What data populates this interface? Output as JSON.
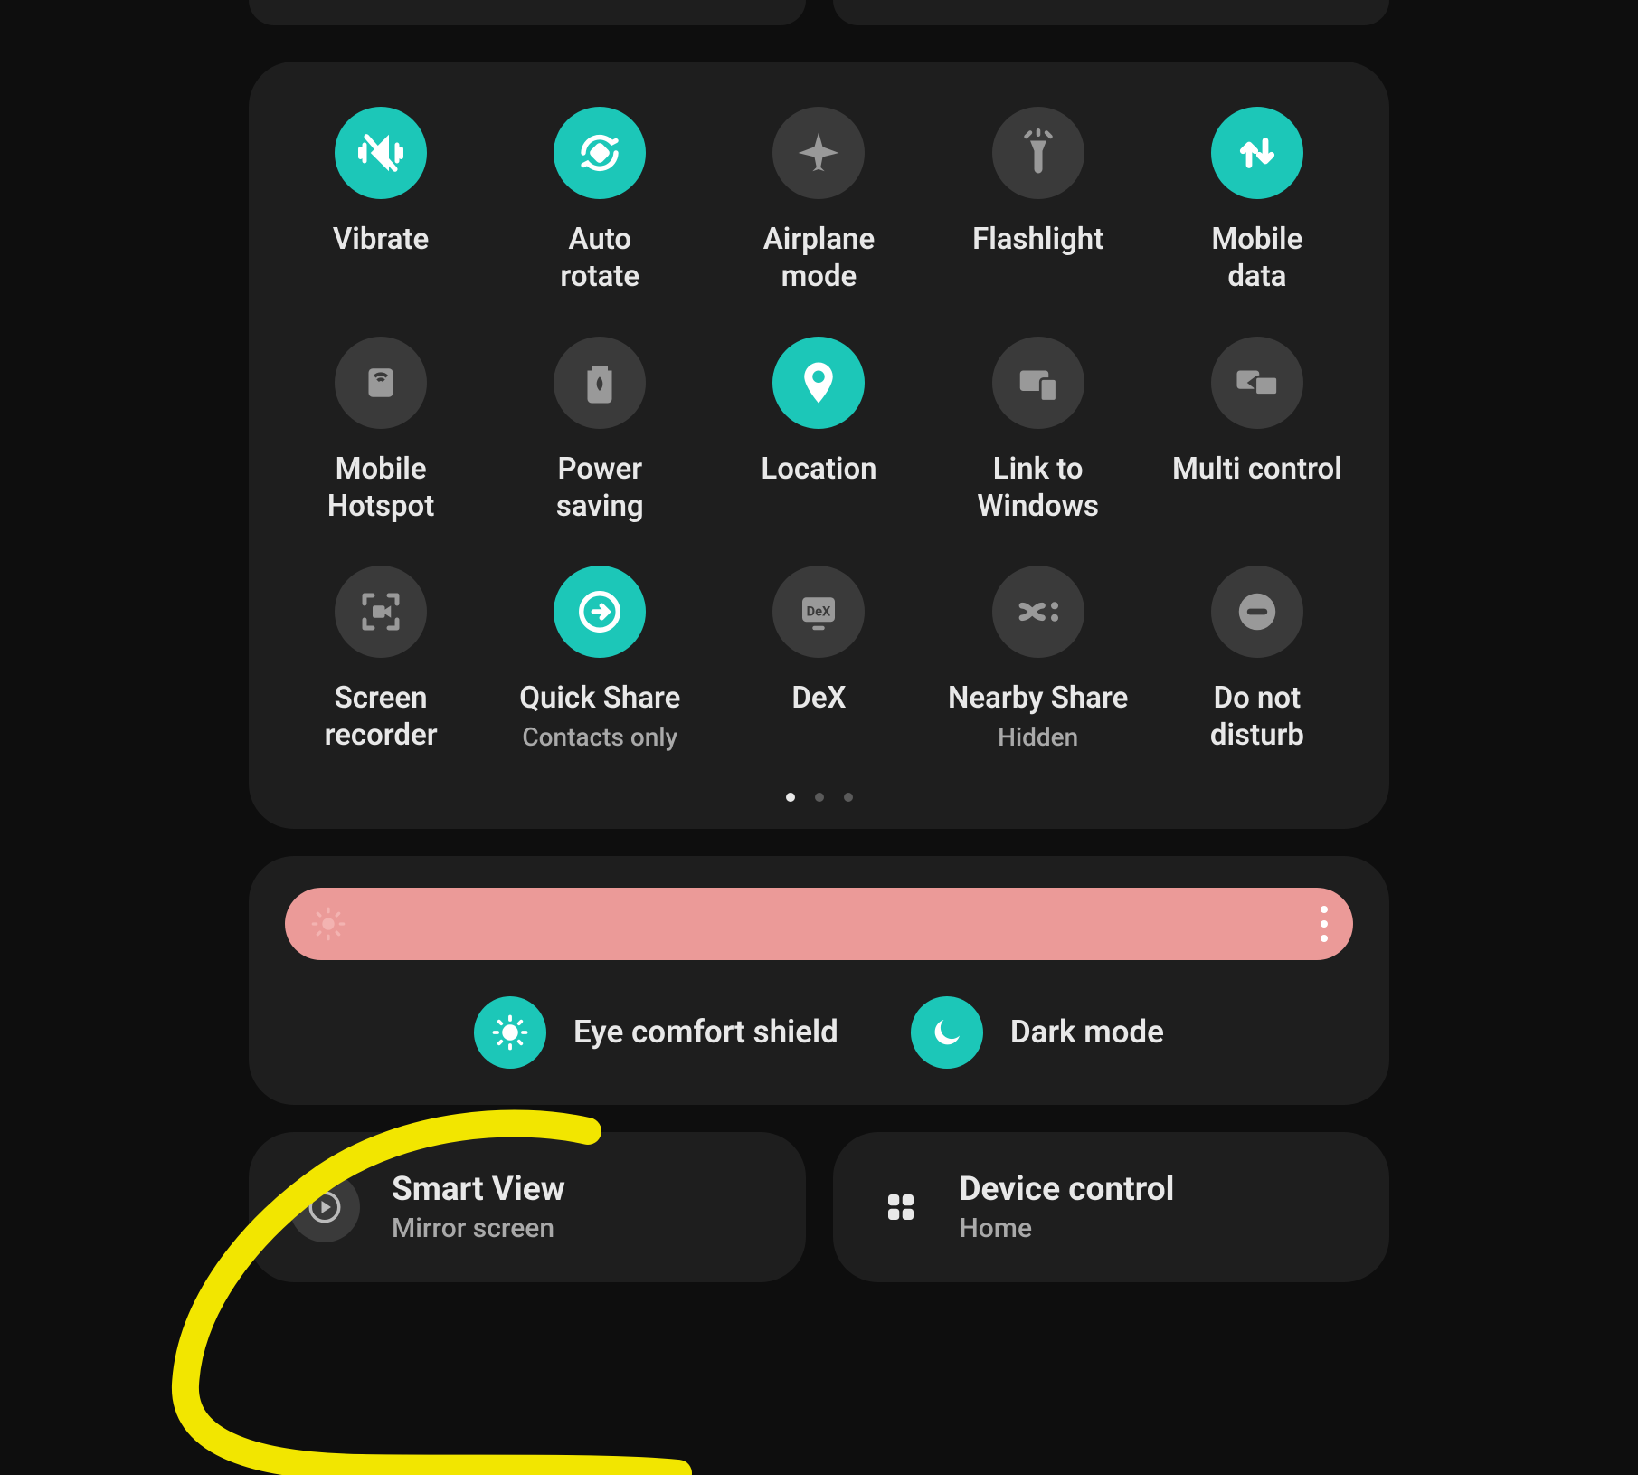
{
  "tiles": [
    {
      "label": "Vibrate",
      "active": true
    },
    {
      "label": "Auto\nrotate",
      "active": true
    },
    {
      "label": "Airplane\nmode",
      "active": false
    },
    {
      "label": "Flashlight",
      "active": false
    },
    {
      "label": "Mobile\ndata",
      "active": true
    },
    {
      "label": "Mobile\nHotspot",
      "active": false
    },
    {
      "label": "Power\nsaving",
      "active": false
    },
    {
      "label": "Location",
      "active": true
    },
    {
      "label": "Link to\nWindows",
      "active": false
    },
    {
      "label": "Multi control",
      "active": false
    },
    {
      "label": "Screen\nrecorder",
      "active": false
    },
    {
      "label": "Quick Share",
      "sub": "Contacts only",
      "active": true
    },
    {
      "label": "DeX",
      "active": false
    },
    {
      "label": "Nearby Share",
      "sub": "Hidden",
      "active": false
    },
    {
      "label": "Do not\ndisturb",
      "active": false
    }
  ],
  "pills": {
    "eye": "Eye comfort shield",
    "dark": "Dark mode"
  },
  "cards": {
    "smartview": {
      "title": "Smart View",
      "sub": "Mirror screen"
    },
    "device": {
      "title": "Device control",
      "sub": "Home"
    }
  },
  "colors": {
    "accent": "#1cc7b8",
    "panel": "#1e1e1e",
    "brightness_bar": "#eb9a98",
    "annotation": "#f2e600"
  }
}
